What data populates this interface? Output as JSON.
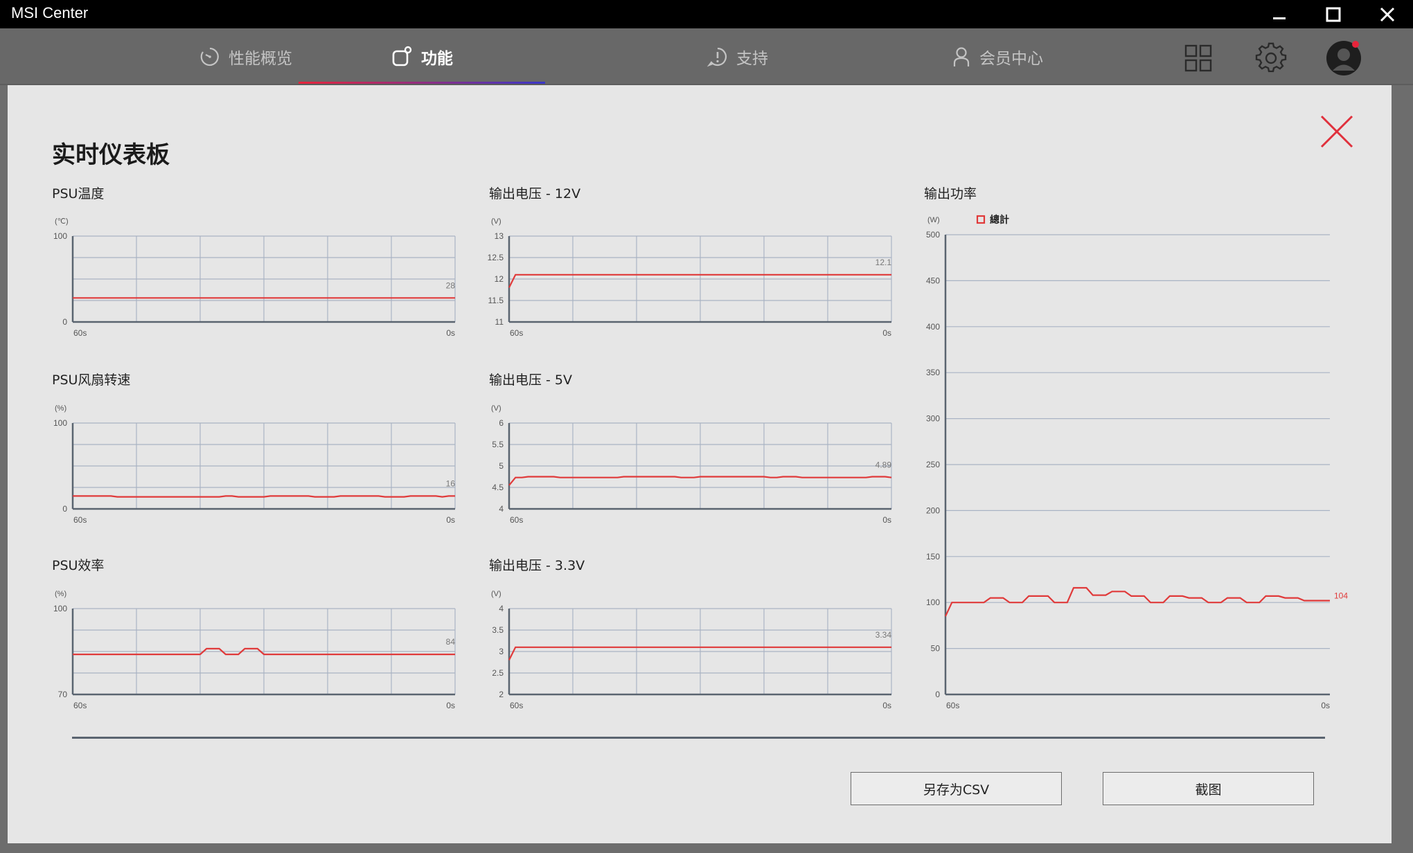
{
  "window": {
    "title": "MSI Center"
  },
  "nav": {
    "tabs": [
      {
        "label": "性能概览",
        "icon": "gauge-icon",
        "active": false
      },
      {
        "label": "功能",
        "icon": "feature-icon",
        "active": true
      },
      {
        "label": "支持",
        "icon": "support-icon",
        "active": false
      },
      {
        "label": "会员中心",
        "icon": "user-icon",
        "active": false
      }
    ],
    "right_icons": [
      "grid-icon",
      "gear-icon",
      "avatar"
    ],
    "notification_dot_color": "#e8243b",
    "active_underline_colors": [
      "#e8243b",
      "#3a36c8"
    ]
  },
  "dashboard": {
    "title": "实时仪表板",
    "line_color": "#e03a3a",
    "buttons": {
      "save_csv": "另存为CSV",
      "screenshot": "截图"
    }
  },
  "chart_data": [
    {
      "id": "psu-temp",
      "type": "line",
      "title": "PSU温度",
      "unit": "(℃)",
      "ylim": [
        0,
        100
      ],
      "yticks": [
        "100",
        "0"
      ],
      "xticks": [
        "60s",
        "0s"
      ],
      "current_label": "28",
      "values": [
        28,
        28,
        28,
        28,
        28,
        28,
        28,
        28,
        28,
        28,
        28,
        28,
        28,
        28,
        28,
        28,
        28,
        28,
        28,
        28,
        28,
        28,
        28,
        28,
        28,
        28,
        28,
        28,
        28,
        28,
        28,
        28,
        28,
        28,
        28,
        28,
        28,
        28,
        28,
        28,
        28,
        28,
        28,
        28,
        28,
        28,
        28,
        28,
        28,
        28,
        28,
        28,
        28,
        28,
        28,
        28,
        28,
        28,
        28,
        28,
        28
      ]
    },
    {
      "id": "v12",
      "type": "line",
      "title": "输出电压 - 12V",
      "unit": "(V)",
      "ylim": [
        11,
        13
      ],
      "yticks": [
        "13",
        "12.5",
        "12",
        "11.5",
        "11"
      ],
      "xticks": [
        "60s",
        "0s"
      ],
      "current_label": "12.1",
      "values": [
        11.8,
        12.1,
        12.1,
        12.1,
        12.1,
        12.1,
        12.1,
        12.1,
        12.1,
        12.1,
        12.1,
        12.1,
        12.1,
        12.1,
        12.1,
        12.1,
        12.1,
        12.1,
        12.1,
        12.1,
        12.1,
        12.1,
        12.1,
        12.1,
        12.1,
        12.1,
        12.1,
        12.1,
        12.1,
        12.1,
        12.1,
        12.1,
        12.1,
        12.1,
        12.1,
        12.1,
        12.1,
        12.1,
        12.1,
        12.1,
        12.1,
        12.1,
        12.1,
        12.1,
        12.1,
        12.1,
        12.1,
        12.1,
        12.1,
        12.1,
        12.1,
        12.1,
        12.1,
        12.1,
        12.1,
        12.1,
        12.1,
        12.1,
        12.1,
        12.1,
        12.1
      ]
    },
    {
      "id": "fan",
      "type": "line",
      "title": "PSU风扇转速",
      "unit": "(%)",
      "ylim": [
        0,
        100
      ],
      "yticks": [
        "100",
        "0"
      ],
      "xticks": [
        "60s",
        "0s"
      ],
      "current_label": "16",
      "values": [
        15,
        15,
        15,
        15,
        15,
        15,
        15,
        14,
        14,
        14,
        14,
        14,
        14,
        14,
        14,
        14,
        14,
        14,
        14,
        14,
        14,
        14,
        14,
        14,
        15,
        15,
        14,
        14,
        14,
        14,
        14,
        15,
        15,
        15,
        15,
        15,
        15,
        15,
        14,
        14,
        14,
        14,
        15,
        15,
        15,
        15,
        15,
        15,
        15,
        14,
        14,
        14,
        14,
        15,
        15,
        15,
        15,
        15,
        14,
        15,
        15
      ]
    },
    {
      "id": "v5",
      "type": "line",
      "title": "输出电压  - 5V",
      "unit": "(V)",
      "ylim": [
        4,
        6
      ],
      "yticks": [
        "6",
        "5.5",
        "5",
        "4.5",
        "4"
      ],
      "xticks": [
        "60s",
        "0s"
      ],
      "current_label": "4.89",
      "values": [
        4.55,
        4.73,
        4.73,
        4.75,
        4.75,
        4.75,
        4.75,
        4.75,
        4.73,
        4.73,
        4.73,
        4.73,
        4.73,
        4.73,
        4.73,
        4.73,
        4.73,
        4.73,
        4.75,
        4.75,
        4.75,
        4.75,
        4.75,
        4.75,
        4.75,
        4.75,
        4.75,
        4.73,
        4.73,
        4.73,
        4.75,
        4.75,
        4.75,
        4.75,
        4.75,
        4.75,
        4.75,
        4.75,
        4.75,
        4.75,
        4.75,
        4.73,
        4.73,
        4.75,
        4.75,
        4.75,
        4.73,
        4.73,
        4.73,
        4.73,
        4.73,
        4.73,
        4.73,
        4.73,
        4.73,
        4.73,
        4.73,
        4.75,
        4.75,
        4.75,
        4.73
      ]
    },
    {
      "id": "efficiency",
      "type": "line",
      "title": "PSU效率",
      "unit": "(%)",
      "ylim": [
        70,
        100
      ],
      "yticks": [
        "100",
        "70"
      ],
      "xticks": [
        "60s",
        "0s"
      ],
      "current_label": "84",
      "values": [
        84,
        84,
        84,
        84,
        84,
        84,
        84,
        84,
        84,
        84,
        84,
        84,
        84,
        84,
        84,
        84,
        84,
        84,
        84,
        84,
        84,
        86,
        86,
        86,
        84,
        84,
        84,
        86,
        86,
        86,
        84,
        84,
        84,
        84,
        84,
        84,
        84,
        84,
        84,
        84,
        84,
        84,
        84,
        84,
        84,
        84,
        84,
        84,
        84,
        84,
        84,
        84,
        84,
        84,
        84,
        84,
        84,
        84,
        84,
        84,
        84
      ]
    },
    {
      "id": "v33",
      "type": "line",
      "title": "输出电压  - 3.3V",
      "unit": "(V)",
      "ylim": [
        2,
        4
      ],
      "yticks": [
        "4",
        "3.5",
        "3",
        "2.5",
        "2"
      ],
      "xticks": [
        "60s",
        "0s"
      ],
      "current_label": "3.34",
      "values": [
        2.8,
        3.1,
        3.1,
        3.1,
        3.1,
        3.1,
        3.1,
        3.1,
        3.1,
        3.1,
        3.1,
        3.1,
        3.1,
        3.1,
        3.1,
        3.1,
        3.1,
        3.1,
        3.1,
        3.1,
        3.1,
        3.1,
        3.1,
        3.1,
        3.1,
        3.1,
        3.1,
        3.1,
        3.1,
        3.1,
        3.1,
        3.1,
        3.1,
        3.1,
        3.1,
        3.1,
        3.1,
        3.1,
        3.1,
        3.1,
        3.1,
        3.1,
        3.1,
        3.1,
        3.1,
        3.1,
        3.1,
        3.1,
        3.1,
        3.1,
        3.1,
        3.1,
        3.1,
        3.1,
        3.1,
        3.1,
        3.1,
        3.1,
        3.1,
        3.1,
        3.1
      ]
    },
    {
      "id": "power",
      "type": "line",
      "title": "输出功率",
      "unit": "(W)",
      "ylim": [
        0,
        500
      ],
      "yticks": [
        "500",
        "450",
        "400",
        "350",
        "300",
        "250",
        "200",
        "150",
        "100",
        "50",
        "0"
      ],
      "xticks": [
        "60s",
        "0s"
      ],
      "current_label": "104",
      "legend": "總計",
      "values": [
        85,
        100,
        100,
        100,
        100,
        100,
        100,
        105,
        105,
        105,
        100,
        100,
        100,
        107,
        107,
        107,
        107,
        100,
        100,
        100,
        116,
        116,
        116,
        108,
        108,
        108,
        112,
        112,
        112,
        107,
        107,
        107,
        100,
        100,
        100,
        107,
        107,
        107,
        105,
        105,
        105,
        100,
        100,
        100,
        105,
        105,
        105,
        100,
        100,
        100,
        107,
        107,
        107,
        105,
        105,
        105,
        102,
        102,
        102,
        102,
        102
      ]
    }
  ]
}
